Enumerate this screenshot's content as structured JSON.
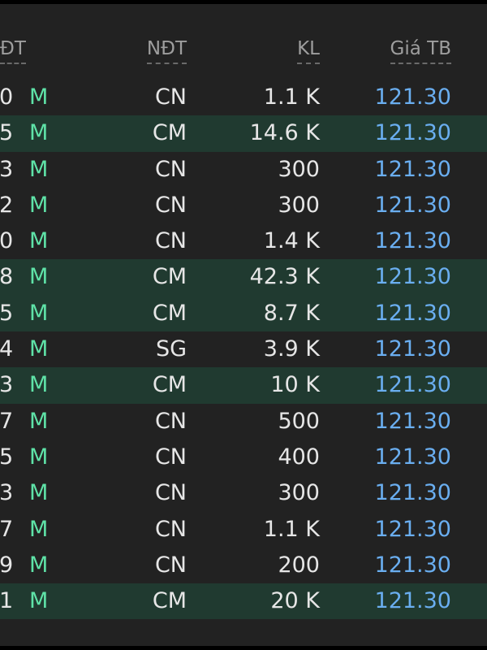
{
  "header": {
    "col_investor": "ĐT",
    "col_investor_type": "NĐT",
    "col_volume": "KL",
    "col_avg_price": "Giá TB"
  },
  "colors": {
    "background": "#222222",
    "highlight_row": "#203a30",
    "side_text": "#5fe3a8",
    "price_text": "#6aaef0"
  },
  "rows": [
    {
      "id": "0",
      "side": "M",
      "type": "CN",
      "volume": "1.1 K",
      "price": "121.30",
      "highlight": false
    },
    {
      "id": "5",
      "side": "M",
      "type": "CM",
      "volume": "14.6 K",
      "price": "121.30",
      "highlight": true
    },
    {
      "id": "3",
      "side": "M",
      "type": "CN",
      "volume": "300",
      "price": "121.30",
      "highlight": false
    },
    {
      "id": "2",
      "side": "M",
      "type": "CN",
      "volume": "300",
      "price": "121.30",
      "highlight": false
    },
    {
      "id": "0",
      "side": "M",
      "type": "CN",
      "volume": "1.4 K",
      "price": "121.30",
      "highlight": false
    },
    {
      "id": "8",
      "side": "M",
      "type": "CM",
      "volume": "42.3 K",
      "price": "121.30",
      "highlight": true
    },
    {
      "id": "5",
      "side": "M",
      "type": "CM",
      "volume": "8.7 K",
      "price": "121.30",
      "highlight": true
    },
    {
      "id": "4",
      "side": "M",
      "type": "SG",
      "volume": "3.9 K",
      "price": "121.30",
      "highlight": false
    },
    {
      "id": "3",
      "side": "M",
      "type": "CM",
      "volume": "10 K",
      "price": "121.30",
      "highlight": true
    },
    {
      "id": "7",
      "side": "M",
      "type": "CN",
      "volume": "500",
      "price": "121.30",
      "highlight": false
    },
    {
      "id": "5",
      "side": "M",
      "type": "CN",
      "volume": "400",
      "price": "121.30",
      "highlight": false
    },
    {
      "id": "3",
      "side": "M",
      "type": "CN",
      "volume": "300",
      "price": "121.30",
      "highlight": false
    },
    {
      "id": "7",
      "side": "M",
      "type": "CN",
      "volume": "1.1 K",
      "price": "121.30",
      "highlight": false
    },
    {
      "id": "9",
      "side": "M",
      "type": "CN",
      "volume": "200",
      "price": "121.30",
      "highlight": false
    },
    {
      "id": "1",
      "side": "M",
      "type": "CM",
      "volume": "20 K",
      "price": "121.30",
      "highlight": true
    }
  ]
}
